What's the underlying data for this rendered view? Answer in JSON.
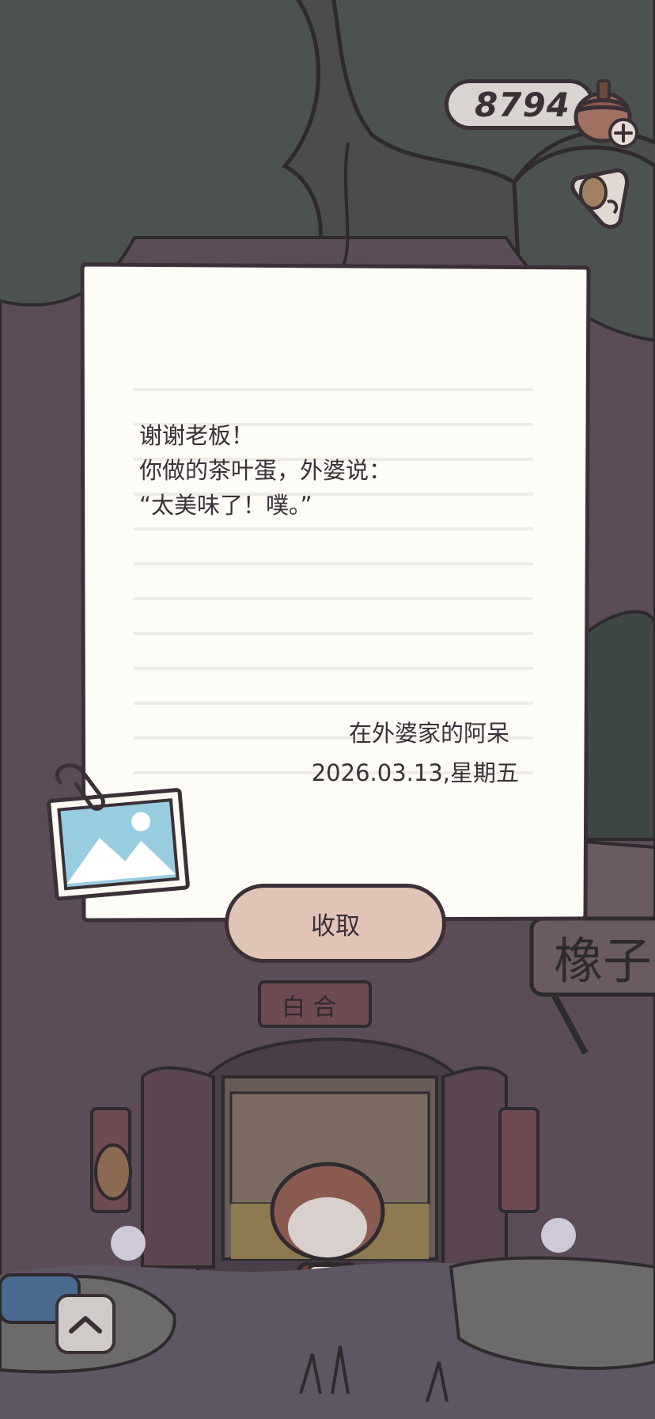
{
  "currency": {
    "acorn_count": "8794",
    "icon": "acorn-icon",
    "add_icon": "plus-icon"
  },
  "side_menu": {
    "icon": "item-menu-icon"
  },
  "letter": {
    "lines": [
      "谢谢老板！",
      "你做的茶叶蛋，外婆说：",
      "“太美味了！噗。”"
    ],
    "signature": "在外婆家的阿呆",
    "date": "2026.03.13,星期五",
    "attachment_icon": "photo-icon",
    "collect_label": "收取"
  },
  "scene": {
    "shop_sign": "橡子",
    "up_button_icon": "chevron-up-icon"
  },
  "colors": {
    "outline": "#3a3036",
    "paper": "#fdfcf7",
    "button": "#e0c4b6",
    "background_tree": "#5b4c58",
    "foliage": "#4b524f"
  }
}
